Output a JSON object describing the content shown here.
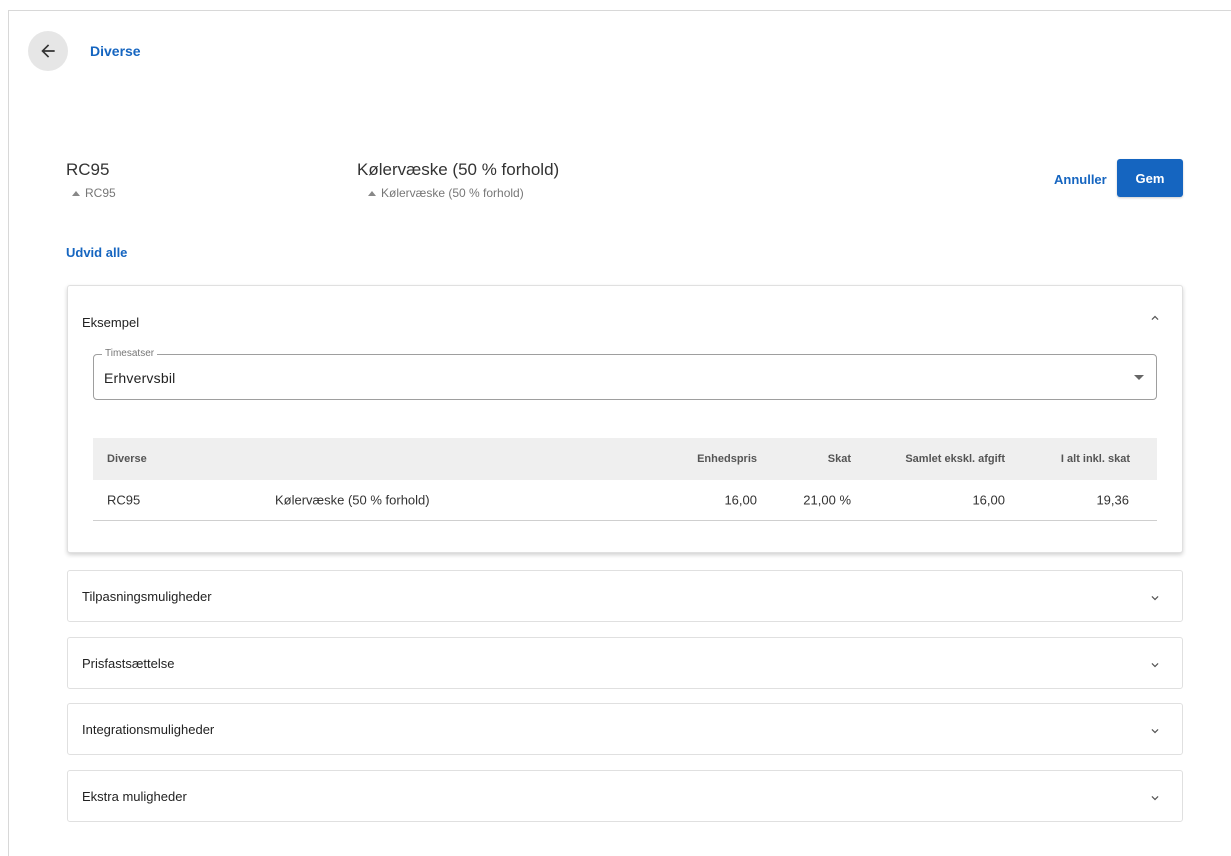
{
  "breadcrumb": "Diverse",
  "item": {
    "code": "RC95",
    "code_sub": "RC95",
    "name": "Kølervæske (50 % forhold)",
    "name_sub": "Kølervæske (50 % forhold)"
  },
  "actions": {
    "cancel": "Annuller",
    "save": "Gem"
  },
  "expand_all": "Udvid alle",
  "panels": {
    "example": {
      "title": "Eksempel",
      "select": {
        "label": "Timesatser",
        "value": "Erhvervsbil"
      },
      "table": {
        "headers": [
          "Diverse",
          "Enhedspris",
          "Skat",
          "Samlet ekskl. afgift",
          "I alt inkl. skat"
        ],
        "row": {
          "code": "RC95",
          "name": "Kølervæske (50 % forhold)",
          "unit_price": "16,00",
          "tax": "21,00 %",
          "total_excl": "16,00",
          "total_incl": "19,36"
        }
      }
    },
    "collapsed": [
      "Tilpasningsmuligheder",
      "Prisfastsættelse",
      "Integrationsmuligheder",
      "Ekstra muligheder"
    ]
  },
  "icons": {
    "back": "arrow-left-icon",
    "collapse": "chevron-up-icon",
    "expand": "chevron-down-icon"
  },
  "colors": {
    "accent": "#1565c0"
  }
}
